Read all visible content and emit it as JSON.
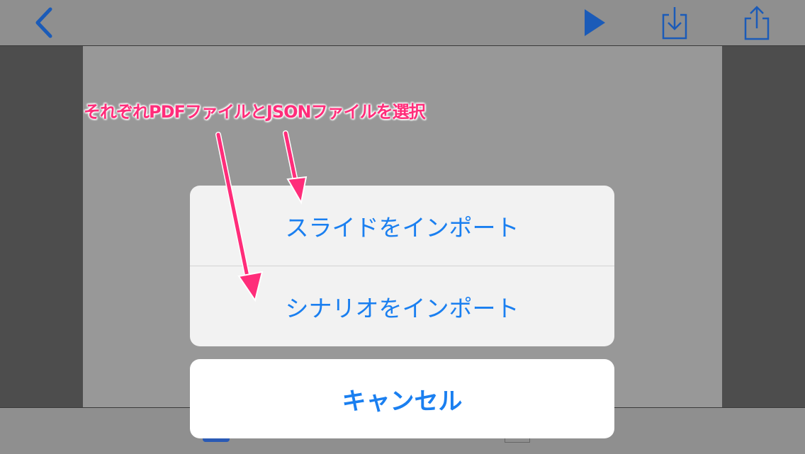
{
  "navbar": {
    "back_icon": "chevron-left-icon",
    "play_icon": "play-icon",
    "download_icon": "tray-download-icon",
    "share_icon": "share-icon",
    "accent_color": "#1b5bb8"
  },
  "annotation": {
    "text": "それぞれPDFファイルとJSONファイルを選択",
    "color": "#ff2d7a"
  },
  "action_sheet": {
    "items": [
      {
        "label": "スライドをインポート"
      },
      {
        "label": "シナリオをインポート"
      }
    ],
    "cancel_label": "キャンセル",
    "accent_color": "#1a7ff0"
  }
}
